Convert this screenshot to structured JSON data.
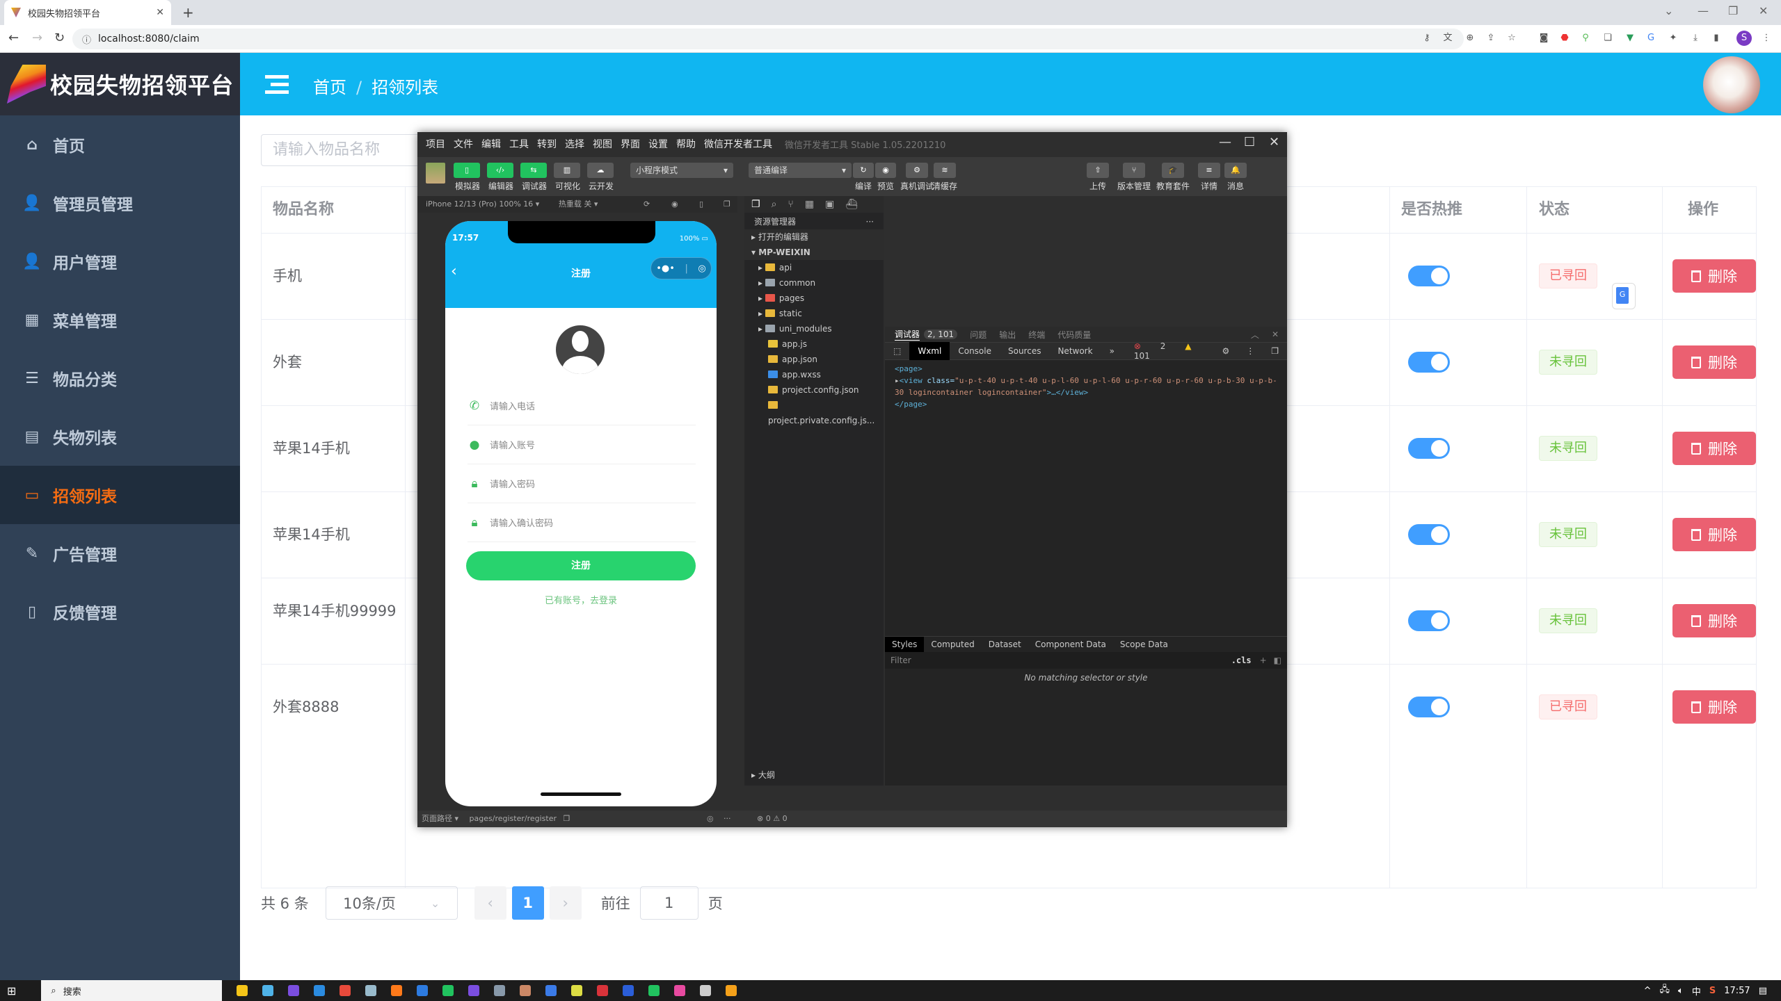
{
  "browser": {
    "tab_title": "校园失物招领平台",
    "url": "localhost:8080/claim",
    "extensions": [
      "key-icon",
      "translate-icon",
      "zoom-icon",
      "share-icon",
      "star-icon",
      "camera-icon",
      "shield-icon",
      "extension-icon",
      "copy-icon",
      "vue-devtools-icon",
      "google-translate-icon",
      "puzzle-icon",
      "download-icon",
      "sidepanel-icon"
    ],
    "profile_initial": "S"
  },
  "app": {
    "title": "校园失物招领平台",
    "accent": "#10b6f1",
    "sidebar_bg": "#304156",
    "active_color": "#f56c12"
  },
  "sidebar": {
    "items": [
      {
        "label": "首页",
        "icon": "home-icon",
        "glyph": "⌂"
      },
      {
        "label": "管理员管理",
        "icon": "admin-user-icon",
        "glyph": "👤"
      },
      {
        "label": "用户管理",
        "icon": "user-icon",
        "glyph": "👤"
      },
      {
        "label": "菜单管理",
        "icon": "grid-icon",
        "glyph": "▦"
      },
      {
        "label": "物品分类",
        "icon": "sliders-icon",
        "glyph": "☰"
      },
      {
        "label": "失物列表",
        "icon": "list-icon",
        "glyph": "▤"
      },
      {
        "label": "招领列表",
        "icon": "monitor-icon",
        "glyph": "▭",
        "active": true
      },
      {
        "label": "广告管理",
        "icon": "edit-icon",
        "glyph": "✎"
      },
      {
        "label": "反馈管理",
        "icon": "document-icon",
        "glyph": "▯"
      }
    ]
  },
  "header": {
    "breadcrumb": [
      "首页",
      "招领列表"
    ],
    "separator": "/"
  },
  "main": {
    "search_placeholder": "请输入物品名称",
    "columns": {
      "name": "物品名称",
      "hot": "是否热推",
      "status": "状态",
      "action": "操作"
    },
    "rows": [
      {
        "name": "手机",
        "hot": true,
        "status": "已寻回",
        "status_type": "red"
      },
      {
        "name": "外套",
        "hot": true,
        "status": "未寻回",
        "status_type": "green"
      },
      {
        "name": "苹果14手机",
        "hot": true,
        "status": "未寻回",
        "status_type": "green"
      },
      {
        "name": "苹果14手机",
        "hot": true,
        "status": "未寻回",
        "status_type": "green"
      },
      {
        "name": "苹果14手机99999",
        "hot": true,
        "status": "未寻回",
        "status_type": "green"
      },
      {
        "name": "外套8888",
        "hot": true,
        "status": "已寻回",
        "status_type": "red"
      }
    ],
    "delete_label": "删除",
    "pagination": {
      "total": "共 6 条",
      "page_size": "10条/页",
      "current_page": "1",
      "goto_label": "前往",
      "goto_value": "1",
      "page_unit": "页"
    }
  },
  "devtools": {
    "menu": [
      "项目",
      "文件",
      "编辑",
      "工具",
      "转到",
      "选择",
      "视图",
      "界面",
      "设置",
      "帮助",
      "微信开发者工具"
    ],
    "title": "微信开发者工具 Stable 1.05.2201210",
    "left_tools": [
      "模拟器",
      "编辑器",
      "调试器",
      "可视化",
      "云开发"
    ],
    "mode_select": "小程序模式",
    "compile_select": "普通编译",
    "mid_tools": [
      "编译",
      "预览",
      "真机调试",
      "清缓存"
    ],
    "right_tools": [
      "上传",
      "版本管理",
      "教育套件",
      "详情",
      "消息"
    ],
    "device": "iPhone 12/13 (Pro) 100% 16 ▾",
    "hot_reload": "热重载 关 ▾",
    "phone": {
      "time": "17:57",
      "battery": "100%",
      "nav_title": "注册",
      "fields": [
        "请输入电话",
        "请输入账号",
        "请输入密码",
        "请输入确认密码"
      ],
      "register_button": "注册",
      "login_link": "已有账号，去登录"
    },
    "explorer": {
      "title": "资源管理器",
      "open_editors": "打开的编辑器",
      "project": "MP-WEIXIN",
      "items": [
        {
          "name": "api",
          "type": "folder",
          "color": "#e8b83b"
        },
        {
          "name": "common",
          "type": "folder",
          "color": "#9aa4ad"
        },
        {
          "name": "pages",
          "type": "folder",
          "color": "#e8564a"
        },
        {
          "name": "static",
          "type": "folder",
          "color": "#e8b83b"
        },
        {
          "name": "uni_modules",
          "type": "folder",
          "color": "#9aa4ad"
        },
        {
          "name": "app.js",
          "type": "file",
          "color": "#e8c33b"
        },
        {
          "name": "app.json",
          "type": "file",
          "color": "#e8b83b"
        },
        {
          "name": "app.wxss",
          "type": "file",
          "color": "#3b8ee8"
        },
        {
          "name": "project.config.json",
          "type": "file",
          "color": "#e8b83b"
        },
        {
          "name": "project.private.config.js...",
          "type": "file",
          "color": "#e8b83b"
        }
      ],
      "outline": "大纲"
    },
    "debugger": {
      "tabs": [
        "调试器",
        "问题",
        "输出",
        "终端",
        "代码质量"
      ],
      "badge": "2, 101",
      "subtabs": [
        "Wxml",
        "Console",
        "Sources",
        "Network"
      ],
      "errors": "2",
      "warnings": "101",
      "wxml_open": "<page>",
      "wxml_view_tag": "<view ",
      "wxml_attr": "class=",
      "wxml_val": "\"u-p-t-40 u-p-t-40 u-p-l-60 u-p-l-60 u-p-r-60 u-p-r-60 u-p-b-30 u-p-b-30 logincontainer logincontainer\"",
      "wxml_close_view": ">…</view>",
      "wxml_close": "</page>",
      "style_tabs": [
        "Styles",
        "Computed",
        "Dataset",
        "Component Data",
        "Scope Data"
      ],
      "filter_placeholder": "Filter",
      "cls": ".cls",
      "no_match": "No matching selector or style"
    },
    "status": {
      "path_label": "页面路径 ▾",
      "path": "pages/register/register",
      "problems": "⊗ 0 ⚠ 0"
    }
  },
  "taskbar": {
    "search": "搜索",
    "time": "17:57",
    "ime": "中"
  }
}
